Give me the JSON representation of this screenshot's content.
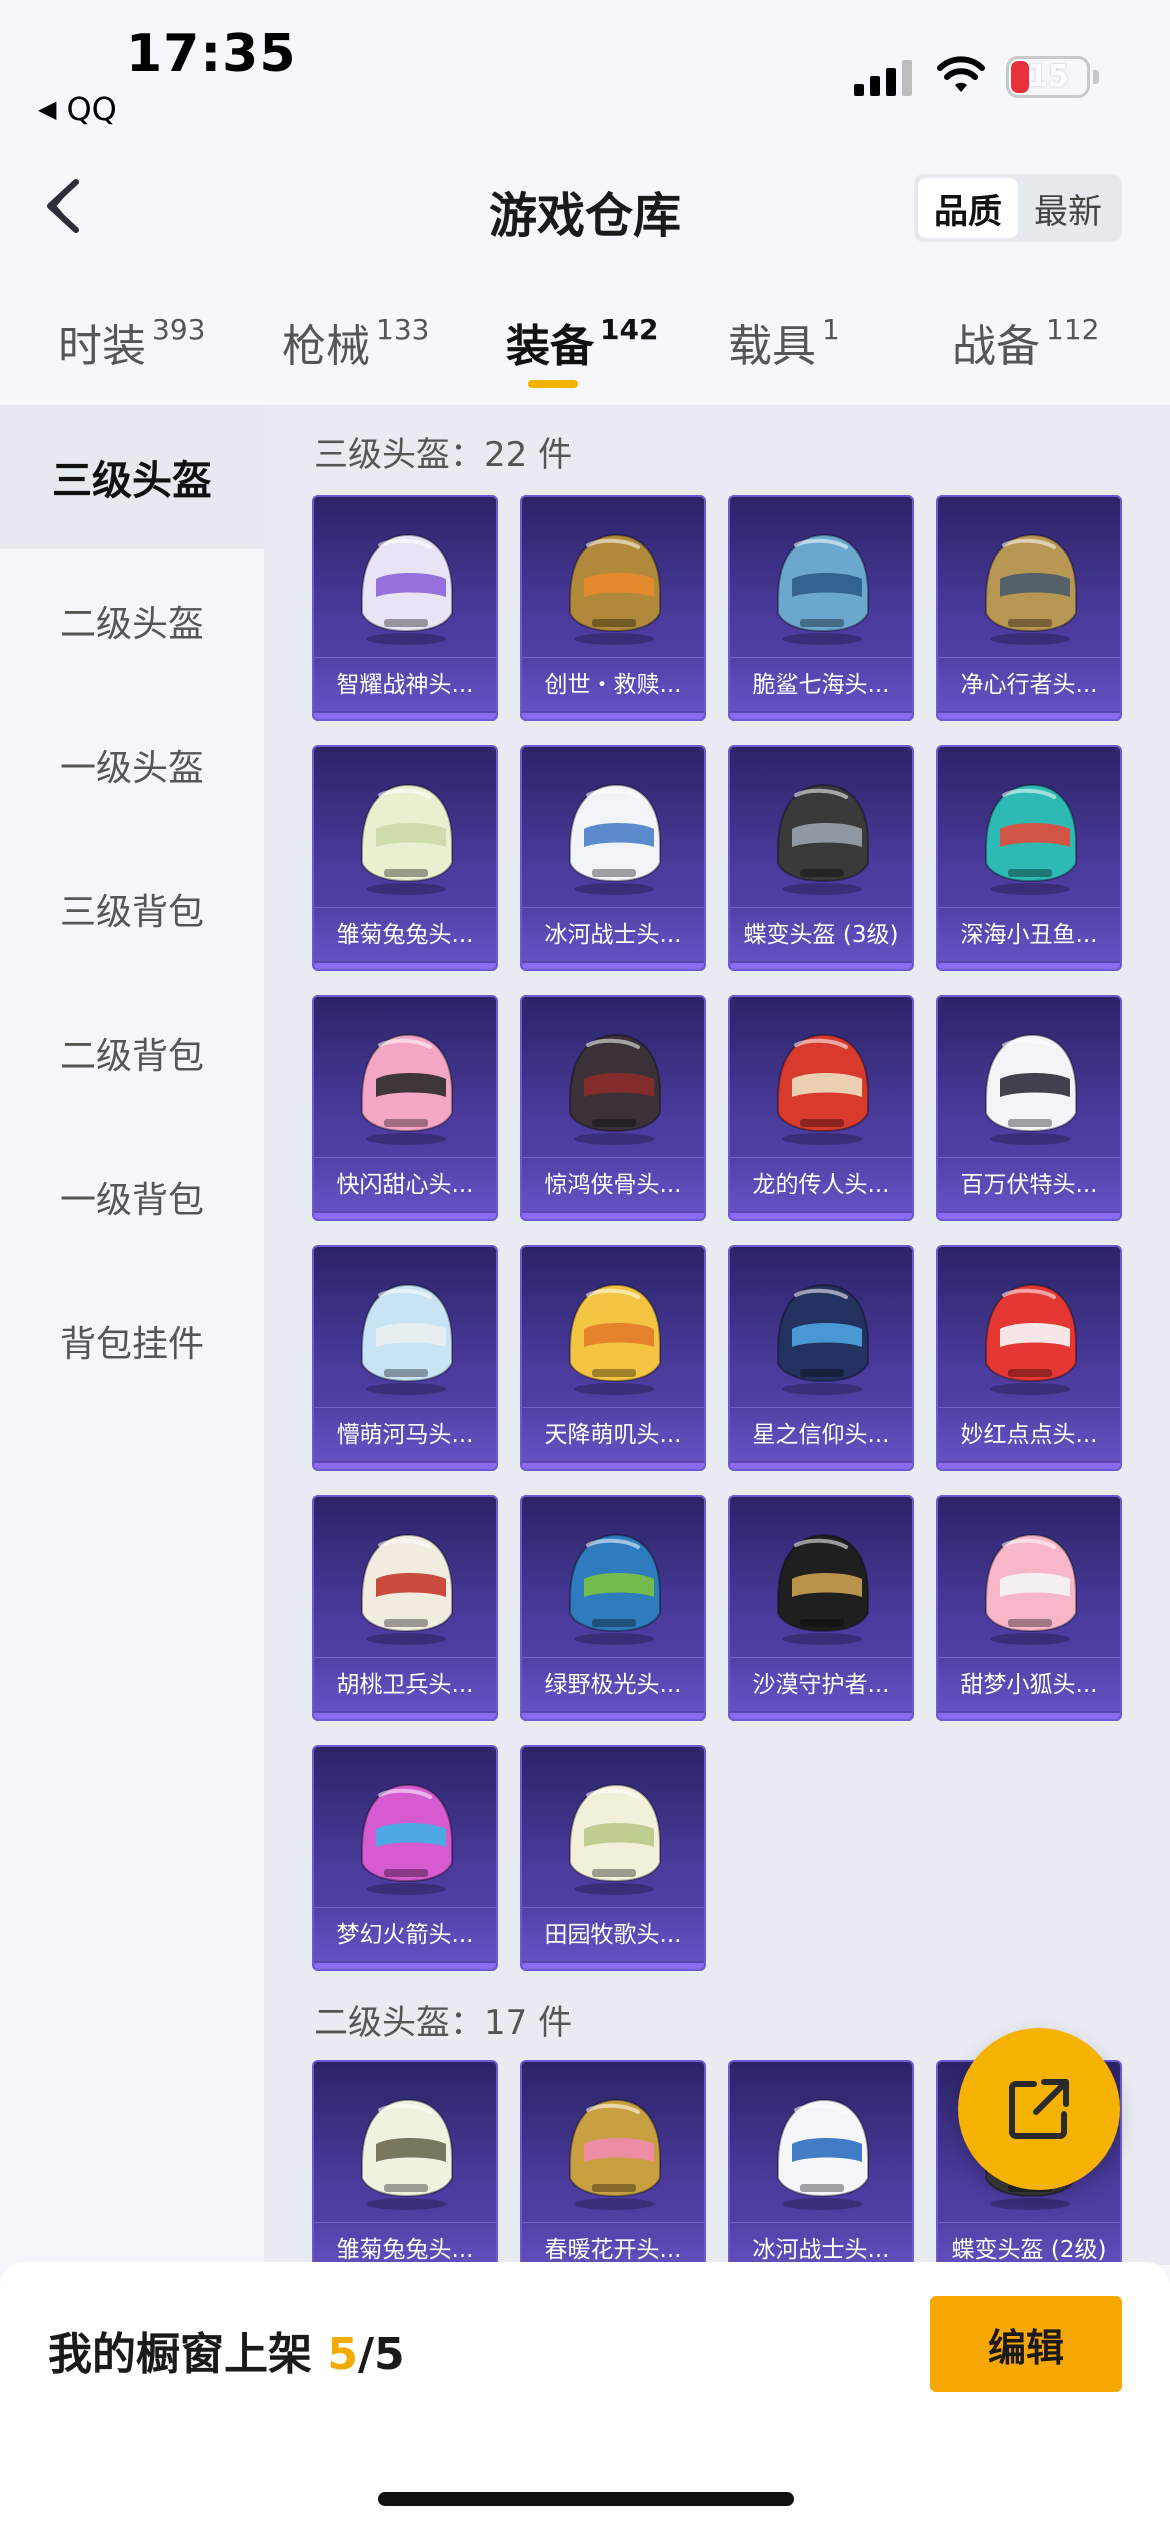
{
  "status": {
    "time": "17:35",
    "back_app": "QQ",
    "battery": "15"
  },
  "header": {
    "title": "游戏仓库",
    "sort": [
      "品质",
      "最新"
    ]
  },
  "tabs": [
    {
      "label": "时装",
      "count": "393"
    },
    {
      "label": "枪械",
      "count": "133"
    },
    {
      "label": "装备",
      "count": "142"
    },
    {
      "label": "载具",
      "count": "1"
    },
    {
      "label": "战备",
      "count": "112"
    }
  ],
  "sidebar": [
    "三级头盔",
    "二级头盔",
    "一级头盔",
    "三级背包",
    "二级背包",
    "一级背包",
    "背包挂件"
  ],
  "sections": [
    {
      "title": "三级头盔：22 件",
      "items": [
        {
          "name": "智耀战神头...",
          "c1": "#e9e4f5",
          "c2": "#8d63d9"
        },
        {
          "name": "创世・救赎...",
          "c1": "#b08a3a",
          "c2": "#e98a2b"
        },
        {
          "name": "脆鲨七海头...",
          "c1": "#6ba7cf",
          "c2": "#2e5c8a"
        },
        {
          "name": "净心行者头...",
          "c1": "#b89654",
          "c2": "#4a5a6a"
        },
        {
          "name": "雏菊兔兔头...",
          "c1": "#e8f0d0",
          "c2": "#cbd8a8"
        },
        {
          "name": "冰河战士头...",
          "c1": "#f0f4f8",
          "c2": "#4a7fc8"
        },
        {
          "name": "蝶变头盔 (3级)",
          "c1": "#3a3a3a",
          "c2": "#9aa3ad"
        },
        {
          "name": "深海小丑鱼...",
          "c1": "#2fb9b4",
          "c2": "#e24a3a"
        },
        {
          "name": "快闪甜心头...",
          "c1": "#f4a7c4",
          "c2": "#2a2a2a"
        },
        {
          "name": "惊鸿侠骨头...",
          "c1": "#3a3236",
          "c2": "#8b2b2b"
        },
        {
          "name": "龙的传人头...",
          "c1": "#d83a2e",
          "c2": "#f0e1c0"
        },
        {
          "name": "百万伏特头...",
          "c1": "#f2f4f6",
          "c2": "#2b2f3a"
        },
        {
          "name": "懵萌河马头...",
          "c1": "#c7e3f4",
          "c2": "#e9eef2"
        },
        {
          "name": "天降萌叽头...",
          "c1": "#f4c542",
          "c2": "#e47a2a"
        },
        {
          "name": "星之信仰头...",
          "c1": "#24325f",
          "c2": "#4fa3e0"
        },
        {
          "name": "妙红点点头...",
          "c1": "#e53834",
          "c2": "#fafafa"
        },
        {
          "name": "胡桃卫兵头...",
          "c1": "#f2ece0",
          "c2": "#c43a2a"
        },
        {
          "name": "绿野极光头...",
          "c1": "#2e7bbd",
          "c2": "#7cc242"
        },
        {
          "name": "沙漠守护者...",
          "c1": "#1f1f1f",
          "c2": "#c8a050"
        },
        {
          "name": "甜梦小狐头...",
          "c1": "#f7b7c8",
          "c2": "#f5f5f5"
        },
        {
          "name": "梦幻火箭头...",
          "c1": "#d65ad0",
          "c2": "#3fb0e6"
        },
        {
          "name": "田园牧歌头...",
          "c1": "#f2f0d8",
          "c2": "#b9c98a"
        }
      ]
    },
    {
      "title": "二级头盔：17 件",
      "items": [
        {
          "name": "雏菊兔兔头...",
          "c1": "#f0f2e0",
          "c2": "#6a6a50"
        },
        {
          "name": "春暖花开头...",
          "c1": "#c9a040",
          "c2": "#f08ab0"
        },
        {
          "name": "冰河战士头...",
          "c1": "#f4f6fa",
          "c2": "#2f6fc0"
        },
        {
          "name": "蝶变头盔 (2级)",
          "c1": "#3a3a3a",
          "c2": "#8a8a8a"
        }
      ]
    }
  ],
  "bottom": {
    "label": "我的橱窗上架 ",
    "current": "5",
    "total": "/5",
    "edit": "编辑"
  },
  "icons": {
    "back": "chevron-left-icon",
    "share": "share-icon"
  },
  "colors": {
    "accent": "#f6b201",
    "card_bg": "#3b2f86"
  }
}
